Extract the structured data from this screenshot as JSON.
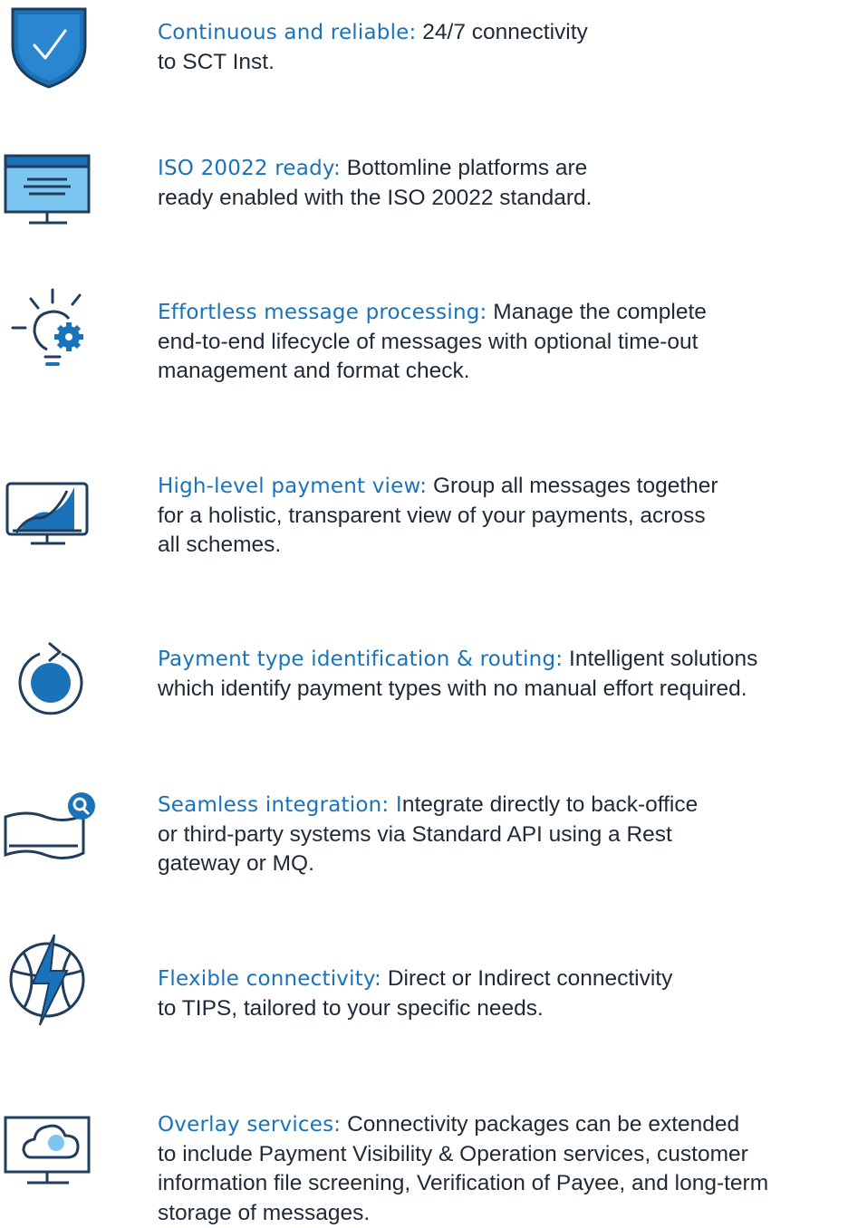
{
  "colors": {
    "accent": "#1a73b8",
    "dark": "#1f3d5c",
    "light_fill": "#7cc7f2",
    "text": "#1f2a36"
  },
  "features": [
    {
      "icon": "shield-check-icon",
      "title": "Continuous and reliable:",
      "lines": [
        "24/7 connectivity",
        "to SCT Inst."
      ]
    },
    {
      "icon": "monitor-document-icon",
      "title": "ISO 20022 ready:",
      "lines": [
        "Bottomline platforms are",
        "ready enabled with the ISO 20022 standard."
      ]
    },
    {
      "icon": "lightbulb-gear-icon",
      "title": "Effortless message processing:",
      "lines": [
        "Manage the complete",
        "end-to-end lifecycle of messages with optional time-out",
        "management and format check."
      ]
    },
    {
      "icon": "monitor-chart-icon",
      "title": "High-level payment view:",
      "lines": [
        "Group all messages together",
        "for a holistic, transparent view of your payments, across",
        "all schemes."
      ]
    },
    {
      "icon": "circular-arrow-icon",
      "title": "Payment type identification & routing:",
      "lines": [
        "Intelligent solutions",
        "which identify payment types with no manual effort required."
      ]
    },
    {
      "icon": "flag-search-icon",
      "title": "Seamless integration: I",
      "lines": [
        "ntegrate directly to back-office",
        "or third-party systems via Standard API using a Rest",
        "gateway or MQ."
      ]
    },
    {
      "icon": "globe-lightning-icon",
      "title": "Flexible connectivity:",
      "lines": [
        "Direct or Indirect connectivity",
        "to TIPS, tailored to your specific needs."
      ]
    },
    {
      "icon": "monitor-cloud-icon",
      "title": "Overlay services:",
      "lines": [
        "Connectivity packages can be extended",
        "to include Payment Visibility & Operation services, customer",
        "information file screening, Verification of Payee, and long-term",
        "storage of messages."
      ]
    }
  ]
}
